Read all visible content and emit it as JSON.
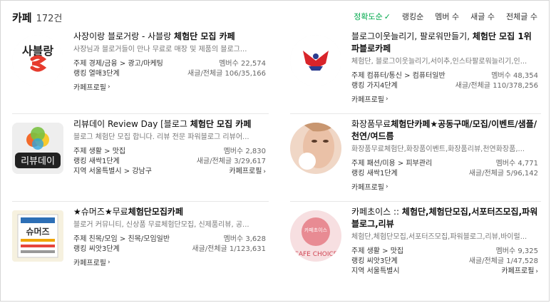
{
  "header": {
    "title": "카페",
    "count": "172건",
    "sorts": [
      "정확도순",
      "랭킹순",
      "멤버 수",
      "새글 수",
      "전체글 수"
    ]
  },
  "cards": [
    {
      "name_html": [
        "사장이랑 블로거랑 - 사블랑 ",
        "체험단 모집 카페"
      ],
      "desc": "사장님과 블로거들이 만나 무료로 매장 및 제품의 블로그...",
      "topic": "주제 경제/금융 > 광고/마케팅",
      "members": "멤버수 22,574",
      "rank": "랭킹 열매3단계",
      "posts": "새글/전체글 106/35,166",
      "region": "",
      "profile": "카페프로필",
      "thumb_text": "사블랑"
    },
    {
      "name_html": [
        "블로그이웃늘리기, 팔로워만들기, ",
        "체험단 모집 1위 파블로카페"
      ],
      "desc": "체험단, 블로그이웃늘리기,서이추,인스타팔로워늘리기,인...",
      "topic": "주제 컴퓨터/통신 > 컴퓨터일반",
      "members": "멤버수 48,354",
      "rank": "랭킹 가지4단계",
      "posts": "새글/전체글 110/378,256",
      "region": "",
      "profile": "카페프로필",
      "thumb_text": ""
    },
    {
      "name_html": [
        "리뷰데이 Review Day [블로그 ",
        "체험단 모집 카페"
      ],
      "desc": "블로그 체험단 모집 합니다. 리뷰 전문 파워블로그 리뷰어...",
      "topic": "주제 생활 > 맛집",
      "members": "멤버수 2,830",
      "rank": "랭킹 새싹1단계",
      "posts": "새글/전체글 3/29,617",
      "region": "지역 서울특별시 > 강남구",
      "profile": "카페프로필",
      "thumb_text": "리뷰데이"
    },
    {
      "name_html": [
        "화장품무료",
        "체험단카페★공동구매/모집/이벤트/샘플/천연/여드름"
      ],
      "desc": "화장품무료체험단,화장품이벤트,화장품리뷰,천연화장품,...",
      "topic": "주제 패션/미용 > 피부관리",
      "members": "멤버수 4,771",
      "rank": "랭킹 새싹1단계",
      "posts": "새글/전체글 5/96,142",
      "region": "",
      "profile": "카페프로필",
      "thumb_text": ""
    },
    {
      "name_html": [
        "★슈머즈★무료",
        "체험단모집카페"
      ],
      "desc": "블로거 커뮤니티, 신상품 무료체험단모집, 신제품리뷰, 공...",
      "topic": "주제 친목/모임 > 친목/모임일반",
      "members": "멤버수 3,628",
      "rank": "랭킹 씨앗3단계",
      "posts": "새글/전체글 1/123,631",
      "region": "",
      "profile": "카페프로필",
      "thumb_text": "슈머즈"
    },
    {
      "name_html": [
        "카페초이스 :: ",
        "체험단,체험단모집,서포터즈모집,파워블로그,리뷰"
      ],
      "desc": "체험단,체험단모집,서포터즈모집,파워블로그,리뷰,바이럴...",
      "topic": "주제 생활 > 맛집",
      "members": "멤버수 9,325",
      "rank": "랭킹 씨앗3단계",
      "posts": "새글/전체글 1/47,528",
      "region": "지역 서울특별시",
      "profile": "카페프로필",
      "thumb_text": "카페초이스"
    }
  ],
  "colors": {
    "accent": "#03a94d",
    "separator": "#e7e7e7"
  }
}
